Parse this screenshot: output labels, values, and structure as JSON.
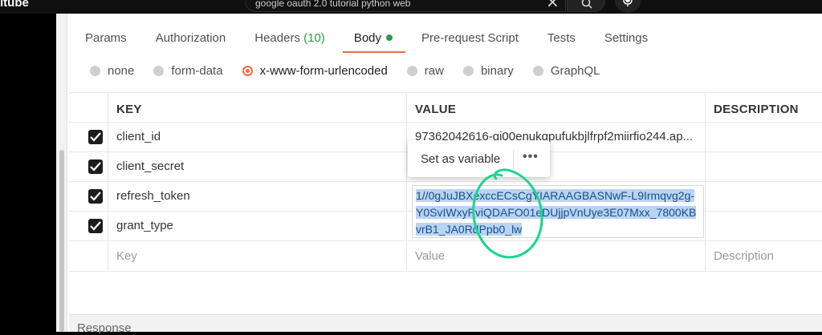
{
  "youtube": {
    "logo_text": "ıtube",
    "search_value": "google oauth 2.0 tutorial python web"
  },
  "tabs": [
    {
      "label": "Params"
    },
    {
      "label": "Authorization"
    },
    {
      "label": "Headers",
      "count": "(10)"
    },
    {
      "label": "Body"
    },
    {
      "label": "Pre-request Script"
    },
    {
      "label": "Tests"
    },
    {
      "label": "Settings"
    }
  ],
  "body_types": [
    "none",
    "form-data",
    "x-www-form-urlencoded",
    "raw",
    "binary",
    "GraphQL"
  ],
  "selected_body_type": "x-www-form-urlencoded",
  "table": {
    "headers": {
      "key": "KEY",
      "value": "VALUE",
      "description": "DESCRIPTION"
    },
    "rows": [
      {
        "key": "client_id",
        "value": "97362042616-gi00enukqpufukbjlfrpf2miirfio244.ap..."
      },
      {
        "key": "client_secret",
        "value": ""
      },
      {
        "key": "refresh_token",
        "value": "1//0gJuJBXexccECsCgYIARAAGBASNwF-L9Irmqvg2g-Y0SvIWxyPviQDAFO01eDUjjpVnUye3E07Mxx_7800KBvrB1_JA0RdPpb0_lw"
      },
      {
        "key": "grant_type",
        "value": ""
      }
    ],
    "placeholder": {
      "key": "Key",
      "value": "Value",
      "description": "Description"
    }
  },
  "context_menu": {
    "set_variable_label": "Set as variable",
    "more_label": "•••"
  },
  "response_label": "Response",
  "colors": {
    "accent": "#f26b3a",
    "body_dot": "#2f9a4f",
    "selection": "#b9d3f3",
    "annotation": "#19d68c"
  }
}
